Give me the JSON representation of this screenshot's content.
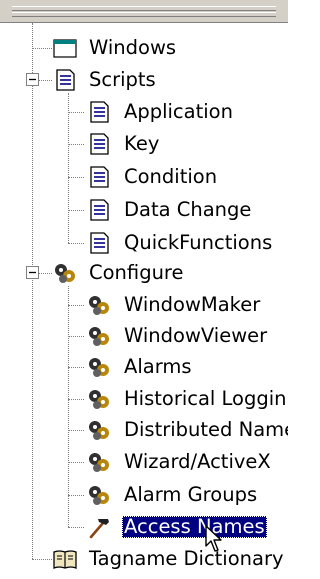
{
  "tree": {
    "windows": {
      "label": "Windows",
      "icon": "window-icon"
    },
    "scripts": {
      "label": "Scripts",
      "icon": "script-page-icon",
      "expander": "minus",
      "children": [
        {
          "label": "Application",
          "icon": "script-page-icon"
        },
        {
          "label": "Key",
          "icon": "script-page-icon"
        },
        {
          "label": "Condition",
          "icon": "script-page-icon"
        },
        {
          "label": "Data Change",
          "icon": "script-page-icon"
        },
        {
          "label": "QuickFunctions",
          "icon": "script-page-icon"
        }
      ]
    },
    "configure": {
      "label": "Configure",
      "icon": "gears-icon",
      "expander": "minus",
      "children": [
        {
          "label": "WindowMaker",
          "icon": "gears-icon"
        },
        {
          "label": "WindowViewer",
          "icon": "gears-icon"
        },
        {
          "label": "Alarms",
          "icon": "gears-icon"
        },
        {
          "label": "Historical Loggin",
          "icon": "gears-icon"
        },
        {
          "label": "Distributed Name",
          "icon": "gears-icon"
        },
        {
          "label": "Wizard/ActiveX",
          "icon": "gears-icon"
        },
        {
          "label": "Alarm Groups",
          "icon": "gears-icon"
        },
        {
          "label": "Access Names",
          "icon": "hammer-icon",
          "selected": true
        }
      ]
    },
    "tagname_dictionary": {
      "label": "Tagname Dictionary",
      "icon": "dictionary-book-icon"
    }
  },
  "colors": {
    "selection": "#000080",
    "panel": "#d4d0c8",
    "tree_lines": "#808080"
  },
  "cursor": "arrow-cursor-icon"
}
